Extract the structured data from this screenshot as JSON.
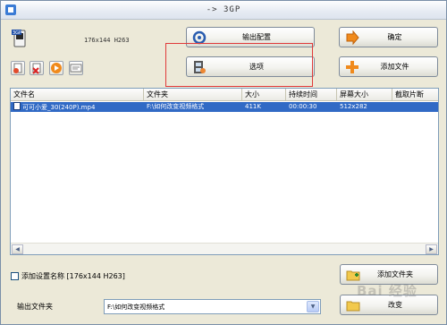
{
  "window": {
    "title": "-> 3GP"
  },
  "format": {
    "resolution_text": "176x144 H263"
  },
  "buttons": {
    "output_config": "输出配置",
    "options": "选项",
    "ok": "确定",
    "add_file": "添加文件",
    "add_folder": "添加文件夹",
    "change": "改变"
  },
  "file_list": {
    "columns": [
      "文件名",
      "文件夹",
      "大小",
      "持续时间",
      "屏幕大小",
      "截取片断"
    ],
    "rows": [
      {
        "name": "可可小爱_30(240P).mp4",
        "folder": "F:\\如何改变视频格式",
        "size": "411K",
        "duration": "00:00:30",
        "screen": "512x282",
        "clip": ""
      }
    ]
  },
  "bottom": {
    "add_setting_label": "添加设置名称 [176x144 H263]",
    "output_folder_label": "输出文件夹",
    "output_folder_value": "F:\\如何改变视频格式"
  },
  "watermark": "Bai 经验",
  "colors": {
    "selection": "#316ac5",
    "highlight_box": "#e03a3a"
  }
}
